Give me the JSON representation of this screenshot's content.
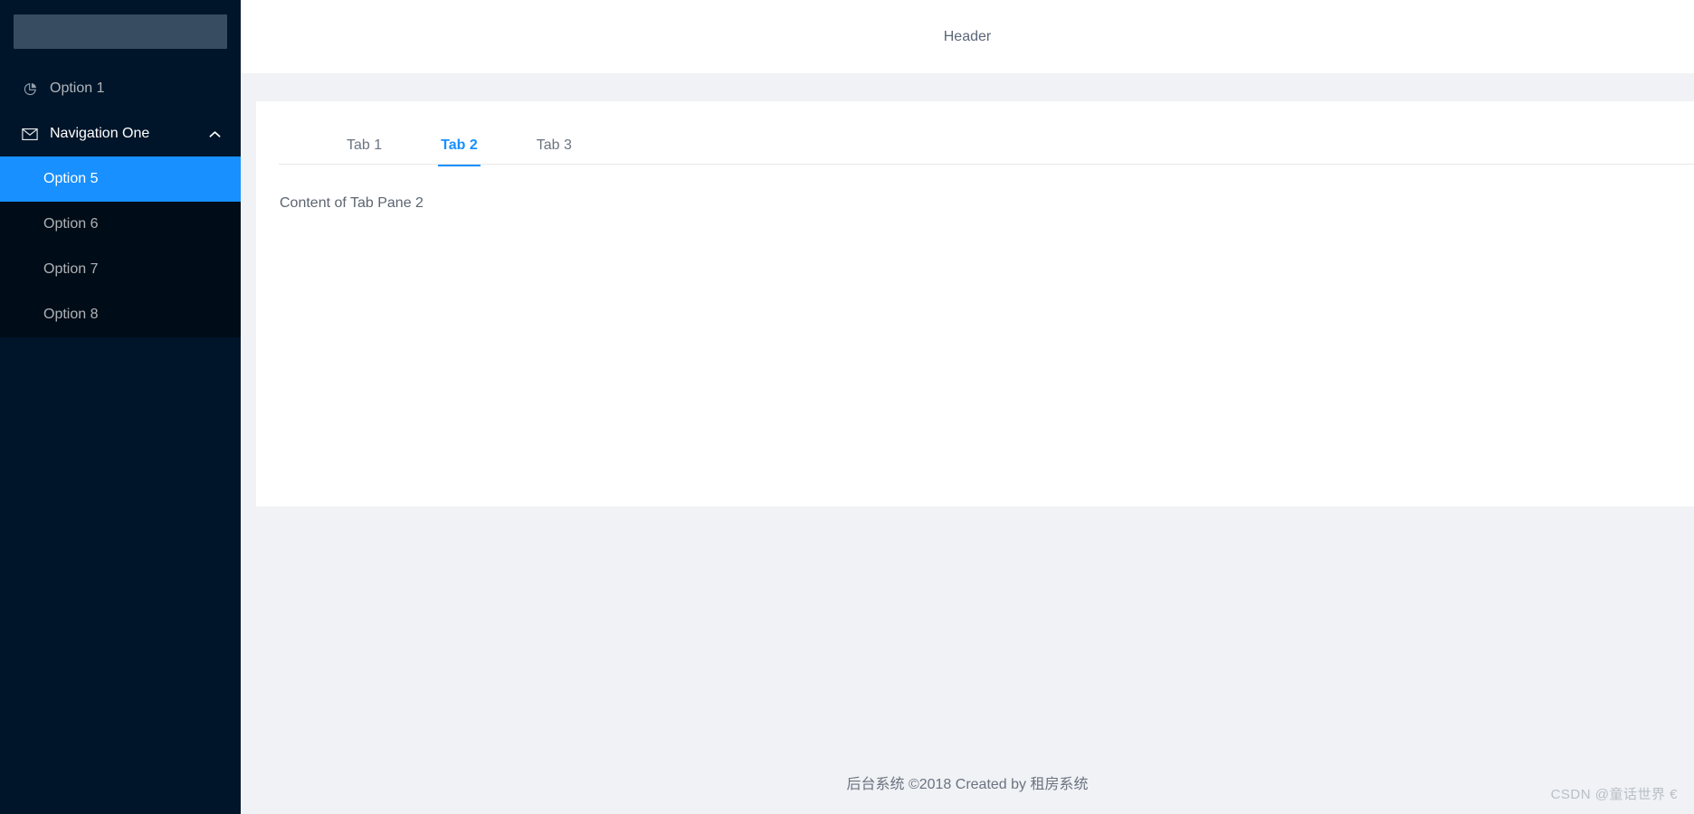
{
  "sidebar": {
    "logo_placeholder_label": "",
    "items": [
      {
        "label": "Option 1",
        "icon": "pie-chart-icon",
        "type": "item"
      },
      {
        "label": "Navigation One",
        "icon": "mail-icon",
        "type": "submenu",
        "expanded": true,
        "arrow_icon": "chevron-up-icon"
      }
    ],
    "submenu_items": [
      {
        "label": "Option 5",
        "active": true
      },
      {
        "label": "Option 6",
        "active": false
      },
      {
        "label": "Option 7",
        "active": false
      },
      {
        "label": "Option 8",
        "active": false
      }
    ],
    "colors": {
      "background": "#001529",
      "submenu_background": "#000c17",
      "active_background": "#1890ff",
      "logo_placeholder": "#374c60"
    }
  },
  "header": {
    "title": "Header"
  },
  "main": {
    "tabs": [
      {
        "label": "Tab 1",
        "active": false
      },
      {
        "label": "Tab 2",
        "active": true
      },
      {
        "label": "Tab 3",
        "active": false
      }
    ],
    "pane_content": "Content of Tab Pane 2",
    "accent_color": "#1890ff"
  },
  "footer": {
    "text": "后台系统 ©2018 Created by 租房系统"
  },
  "watermark": {
    "text": "CSDN @童话世界 €"
  }
}
